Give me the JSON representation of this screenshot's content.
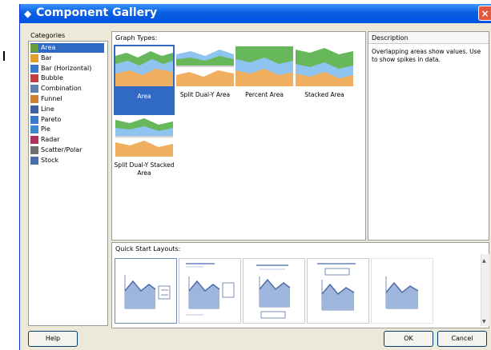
{
  "window": {
    "title": "Component Gallery"
  },
  "categories": {
    "label": "Categories",
    "items": [
      {
        "label": "Area",
        "icon": "area-chart-icon",
        "selected": true
      },
      {
        "label": "Bar",
        "icon": "bar-chart-icon"
      },
      {
        "label": "Bar (Horizontal)",
        "icon": "horizontal-bar-chart-icon"
      },
      {
        "label": "Bubble",
        "icon": "bubble-chart-icon"
      },
      {
        "label": "Combination",
        "icon": "combination-chart-icon"
      },
      {
        "label": "Funnel",
        "icon": "funnel-chart-icon"
      },
      {
        "label": "Line",
        "icon": "line-chart-icon"
      },
      {
        "label": "Pareto",
        "icon": "pareto-chart-icon"
      },
      {
        "label": "Pie",
        "icon": "pie-chart-icon"
      },
      {
        "label": "Radar",
        "icon": "radar-chart-icon"
      },
      {
        "label": "Scatter/Polar",
        "icon": "scatter-chart-icon"
      },
      {
        "label": "Stock",
        "icon": "stock-chart-icon"
      }
    ]
  },
  "graph_types": {
    "label": "Graph Types:",
    "items": [
      {
        "label": "Area",
        "selected": true
      },
      {
        "label": "Split Dual-Y Area"
      },
      {
        "label": "Percent Area"
      },
      {
        "label": "Stacked Area"
      },
      {
        "label": "Split Dual-Y Stacked Area"
      }
    ]
  },
  "description": {
    "label": "Description",
    "text": "Overlapping areas show values. Use to show spikes in data."
  },
  "quick_start": {
    "label": "Quick Start Layouts:"
  },
  "buttons": {
    "help": "Help",
    "ok": "OK",
    "cancel": "Cancel"
  },
  "colors": {
    "selection": "#316ac5",
    "area_blue": "#8fc3f0",
    "area_green": "#66b85a",
    "area_orange": "#f0b060"
  }
}
